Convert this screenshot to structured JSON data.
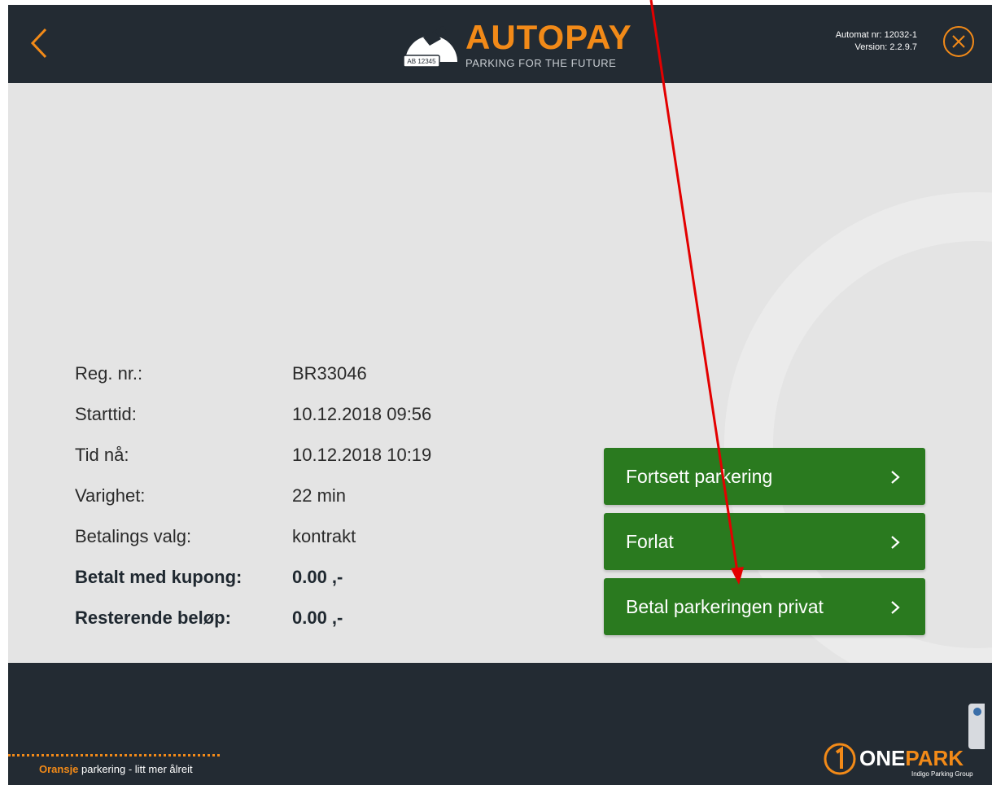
{
  "header": {
    "brand": "AUTOPAY",
    "tagline": "PARKING FOR THE FUTURE",
    "plate_text": "AB 12345",
    "machine_number": "Automat nr: 12032-1",
    "version": "Version: 2.2.9.7"
  },
  "details": [
    {
      "label": "Reg. nr.:",
      "value": "BR33046",
      "bold": false
    },
    {
      "label": "Starttid:",
      "value": "10.12.2018 09:56",
      "bold": false
    },
    {
      "label": "Tid nå:",
      "value": "10.12.2018 10:19",
      "bold": false
    },
    {
      "label": "Varighet:",
      "value": "22 min",
      "bold": false
    },
    {
      "label": "Betalings valg:",
      "value": "kontrakt",
      "bold": false
    },
    {
      "label": "Betalt med kupong:",
      "value": "0.00 ,-",
      "bold": true
    },
    {
      "label": "Resterende beløp:",
      "value": "0.00 ,-",
      "bold": true
    }
  ],
  "actions": [
    {
      "label": "Fortsett parkering",
      "chevron": ">"
    },
    {
      "label": "Forlat",
      "chevron": ">"
    },
    {
      "label": "Betal parkeringen privat",
      "chevron": ">"
    }
  ],
  "footer": {
    "slogan_accent": "Oransje",
    "slogan_rest": " parkering - litt mer ålreit",
    "logo_one": "ONE",
    "logo_park": "PARK",
    "logo_sub": "Indigo Parking Group"
  },
  "colors": {
    "header_bg": "#232b33",
    "accent_orange": "#f28a18",
    "button_green": "#2a7a1f",
    "annotation_red": "#e30000"
  },
  "icons": {
    "back": "chevron-left-icon",
    "close": "close-circle-icon",
    "action_chevron": "chevron-right-icon"
  }
}
